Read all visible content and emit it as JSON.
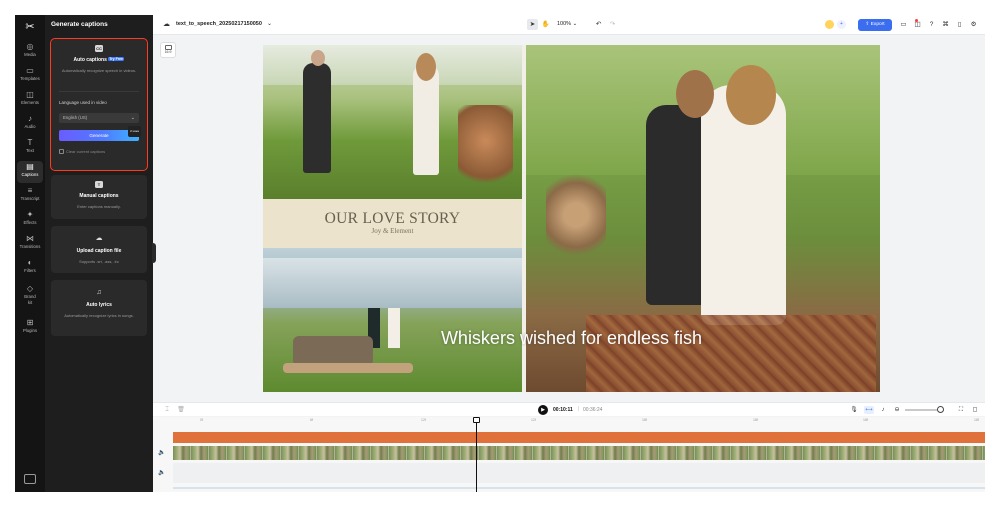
{
  "rail": {
    "logo": "✂",
    "items": [
      {
        "label": "Media",
        "icon": "◎"
      },
      {
        "label": "Templates",
        "icon": "▭"
      },
      {
        "label": "Elements",
        "icon": "◫"
      },
      {
        "label": "Audio",
        "icon": "♪"
      },
      {
        "label": "Text",
        "icon": "T"
      },
      {
        "label": "Captions",
        "icon": "▤"
      },
      {
        "label": "Transcript",
        "icon": "≡"
      },
      {
        "label": "Effects",
        "icon": "✦"
      },
      {
        "label": "Transitions",
        "icon": "⋈"
      },
      {
        "label": "Filters",
        "icon": "◐"
      },
      {
        "label": "Brand kit",
        "icon": "◇"
      },
      {
        "label": "Plugins",
        "icon": "⊞"
      }
    ]
  },
  "panel": {
    "title": "Generate captions",
    "auto": {
      "title": "Auto captions",
      "badge": "Try Free",
      "desc": "Automatically recognize speech in videos.",
      "language_label": "Language used in video",
      "language_value": "English (US)",
      "generate_label": "Generate",
      "generate_badge": "2 uses",
      "clear_label": "Clear current captions"
    },
    "manual": {
      "title": "Manual captions",
      "desc": "Enter captions manually."
    },
    "upload": {
      "title": "Upload caption file",
      "desc": "Supports .srt, .ass, .lrc"
    },
    "lyrics": {
      "title": "Auto lyrics",
      "desc": "Automatically recognize lyrics in songs."
    }
  },
  "topbar": {
    "project_name": "text_to_speech_20250217150050",
    "zoom": "100%",
    "export_label": "Export"
  },
  "canvas": {
    "ratio_label": "16:9",
    "story_title": "OUR LOVE STORY",
    "story_subtitle": "Joy & Element",
    "caption_text": "Whiskers wished for endless fish"
  },
  "playback": {
    "current_time": "00:10:11",
    "separator": "|",
    "total_time": "00:36:24"
  },
  "timeline": {
    "ticks": [
      "0f",
      "6f",
      "12f",
      "12f",
      "18f",
      "18f",
      "18f",
      "18f",
      "18f"
    ]
  },
  "colors": {
    "accent": "#3a6df0",
    "highlight_outline": "#ff3b1f",
    "audio_track": "#e0713a"
  }
}
